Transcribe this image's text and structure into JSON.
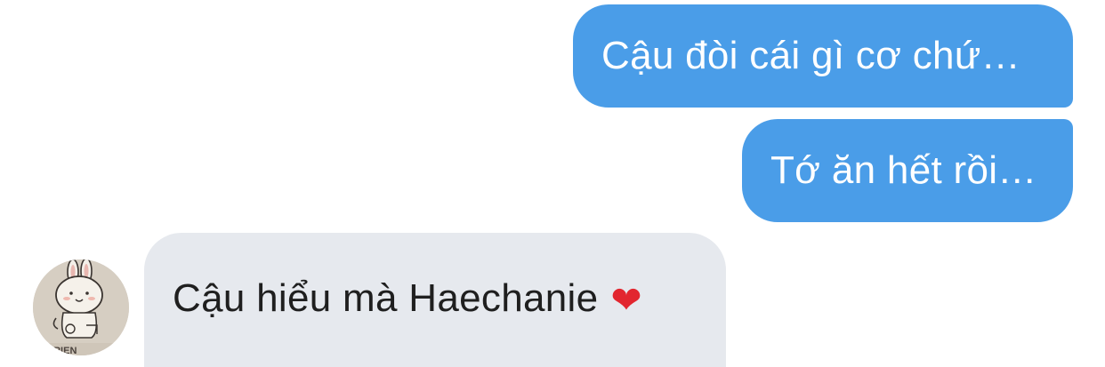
{
  "messages": [
    {
      "direction": "outgoing",
      "text": "Cậu đòi cái gì cơ chứ…"
    },
    {
      "direction": "outgoing",
      "text": "Tớ ăn hết rồi…"
    },
    {
      "direction": "incoming",
      "text": "Cậu hiểu mà Haechanie",
      "emoji": "❤"
    }
  ],
  "avatar": {
    "icon": "bunny-sticker-icon",
    "caption": "E FRIEN"
  },
  "colors": {
    "outgoing_bubble": "#4a9de8",
    "incoming_bubble": "#e6e9ee",
    "heart": "#e2262f"
  }
}
